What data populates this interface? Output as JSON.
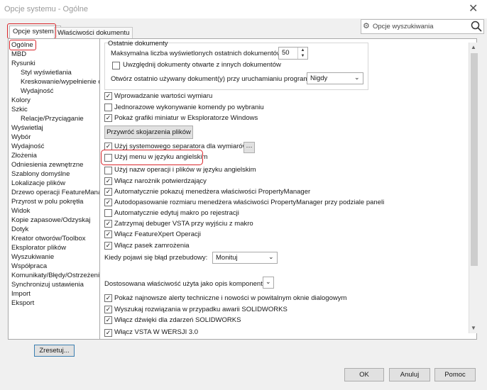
{
  "window": {
    "title": "Opcje systemu - Ogólne",
    "close_glyph": "✕"
  },
  "tabs": [
    {
      "label": "Opcje systemu"
    },
    {
      "label": "Właściwości dokumentu"
    }
  ],
  "search": {
    "placeholder": "Opcje wyszukiwania",
    "icon": "search-icon",
    "settings_icon": "gear-icon"
  },
  "sidebar": {
    "items": [
      {
        "label": "Ogólne"
      },
      {
        "label": "MBD"
      },
      {
        "label": "Rysunki"
      },
      {
        "label": "Styl wyświetlania"
      },
      {
        "label": "Kreskowanie/wypełnienie obs"
      },
      {
        "label": "Wydajność"
      },
      {
        "label": "Kolory"
      },
      {
        "label": "Szkic"
      },
      {
        "label": "Relacje/Przyciąganie"
      },
      {
        "label": "Wyświetlaj"
      },
      {
        "label": "Wybór"
      },
      {
        "label": "Wydajność"
      },
      {
        "label": "Złożenia"
      },
      {
        "label": "Odniesienia zewnętrzne"
      },
      {
        "label": "Szablony domyślne"
      },
      {
        "label": "Lokalizacje plików"
      },
      {
        "label": "Drzewo operacji FeatureManage"
      },
      {
        "label": "Przyrost w polu pokrętła"
      },
      {
        "label": "Widok"
      },
      {
        "label": "Kopie zapasowe/Odzyskaj"
      },
      {
        "label": "Dotyk"
      },
      {
        "label": "Kreator otworów/Toolbox"
      },
      {
        "label": "Eksplorator plików"
      },
      {
        "label": "Wyszukiwanie"
      },
      {
        "label": "Współpraca"
      },
      {
        "label": "Komunikaty/Błędy/Ostrzeżenia"
      },
      {
        "label": "Synchronizuj ustawienia"
      },
      {
        "label": "Import"
      },
      {
        "label": "Eksport"
      }
    ],
    "reset_label": "Zresetuj..."
  },
  "recent": {
    "group_title": "Ostatnie dokumenty",
    "max_label": "Maksymalna liczba wyświetlonych ostatnich dokumentów:",
    "max_value": "50",
    "include_label": "Uwzględnij dokumenty otwarte z innych dokumentów",
    "open_label": "Otwórz ostatnio używany dokument(y) przy uruchamianiu programu:",
    "open_value": "Nigdy"
  },
  "checks1": [
    {
      "label": "Wprowadzanie wartości wymiaru",
      "checked": true
    },
    {
      "label": "Jednorazowe wykonywanie komendy po wybraniu",
      "checked": false
    },
    {
      "label": "Pokaż grafiki miniatur w Eksploratorze Windows",
      "checked": true
    }
  ],
  "restore_label": "Przywróć skojarzenia plików",
  "checks2": [
    {
      "label": "Użyj systemowego separatora dla wymiarów",
      "checked": true
    },
    {
      "label": "Użyj menu w języku angielskim",
      "checked": false
    },
    {
      "label": "Użyj nazw operacji i plików w języku angielskim",
      "checked": false
    },
    {
      "label": "Włącz narożnik potwierdzający",
      "checked": true
    },
    {
      "label": "Automatycznie pokazuj menedżera właściwości PropertyManager",
      "checked": true
    },
    {
      "label": "Autodopasowanie rozmiaru menedżera właściwości PropertyManager przy podziale paneli",
      "checked": true
    },
    {
      "label": "Automatycznie edytuj makro po rejestracji",
      "checked": false
    },
    {
      "label": "Zatrzymaj debuger VSTA przy wyjściu z makro",
      "checked": true
    },
    {
      "label": "Włącz FeatureXpert Operacji",
      "checked": true
    },
    {
      "label": "Włącz pasek zamrożenia",
      "checked": true
    }
  ],
  "rebuild": {
    "label": "Kiedy pojawi się błąd przebudowy:",
    "value": "Monituj"
  },
  "custom_prop_label": "Dostosowana właściwość użyta jako opis komponentu:",
  "checks3": [
    {
      "label": "Pokaż najnowsze alerty techniczne i nowości w powitalnym oknie dialogowym",
      "checked": true
    },
    {
      "label": "Wyszukaj rozwiązania w przypadku awarii SOLIDWORKS",
      "checked": true
    },
    {
      "label": "Włącz dźwięki dla zdarzeń SOLIDWORKS",
      "checked": true
    },
    {
      "label": "Włącz VSTA W WERSJI 3.0",
      "checked": true
    }
  ],
  "footer": {
    "ok": "OK",
    "cancel": "Anuluj",
    "help": "Pomoc"
  },
  "colors": {
    "highlight": "#d9262b"
  }
}
